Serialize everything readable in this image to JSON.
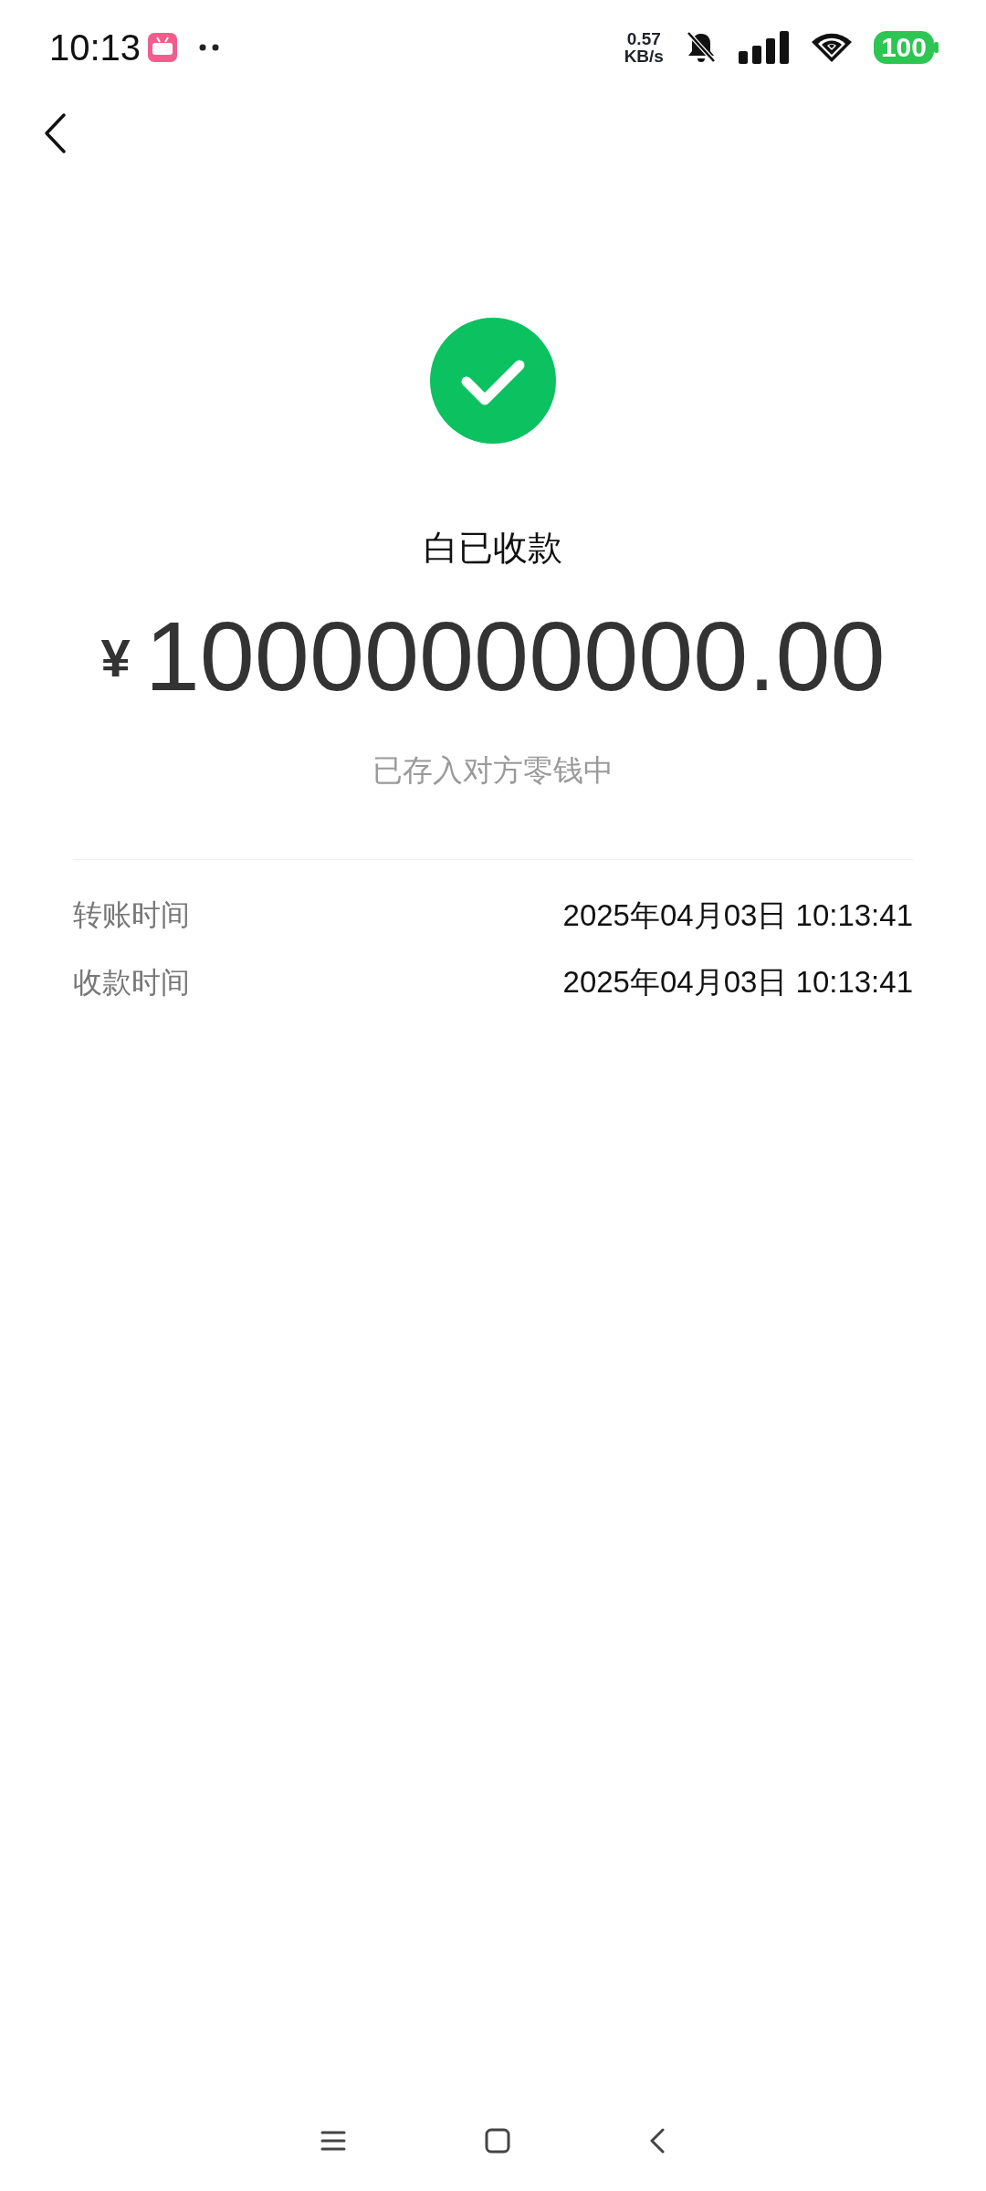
{
  "status_bar": {
    "time": "10:13",
    "net_speed": [
      "0.57",
      "KB/s"
    ],
    "battery": "100"
  },
  "result": {
    "status": "白已收款",
    "currency": "¥",
    "amount": "10000000000.00",
    "note": "已存入对方零钱中"
  },
  "details": [
    {
      "label": "转账时间",
      "value": "2025年04月03日 10:13:41"
    },
    {
      "label": "收款时间",
      "value": "2025年04月03日 10:13:41"
    }
  ]
}
